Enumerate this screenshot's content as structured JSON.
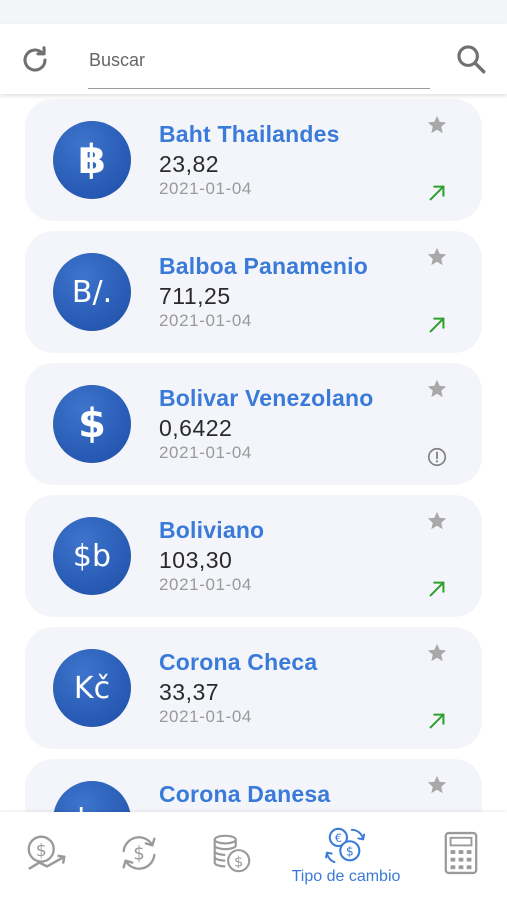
{
  "search": {
    "placeholder": "Buscar"
  },
  "currencies": [
    {
      "symbol": "฿",
      "name": "Baht Thailandes",
      "value": "23,82",
      "date": "2021-01-04",
      "status": "up"
    },
    {
      "symbol": "B/.",
      "name": "Balboa Panamenio",
      "value": "711,25",
      "date": "2021-01-04",
      "status": "up"
    },
    {
      "symbol": "$",
      "name": "Bolivar Venezolano",
      "value": "0,6422",
      "date": "2021-01-04",
      "status": "info"
    },
    {
      "symbol": "$b",
      "name": "Boliviano",
      "value": "103,30",
      "date": "2021-01-04",
      "status": "up"
    },
    {
      "symbol": "Kč",
      "name": "Corona Checa",
      "value": "33,37",
      "date": "2021-01-04",
      "status": "up"
    },
    {
      "symbol": "kr",
      "name": "Corona Danesa",
      "value": "",
      "date": "",
      "status": ""
    }
  ],
  "nav": {
    "active_label": "Tipo de cambio",
    "items": [
      "money-growth-icon",
      "currency-exchange-icon",
      "coins-icon",
      "euro-dollar-exchange-icon",
      "calculator-icon"
    ]
  },
  "colors": {
    "accent": "#3a7ad9",
    "coin": "#2b5fb8",
    "card_bg": "#f3f5fa",
    "trend_up": "#2ca02c",
    "icon_gray": "#9a9a9a"
  }
}
